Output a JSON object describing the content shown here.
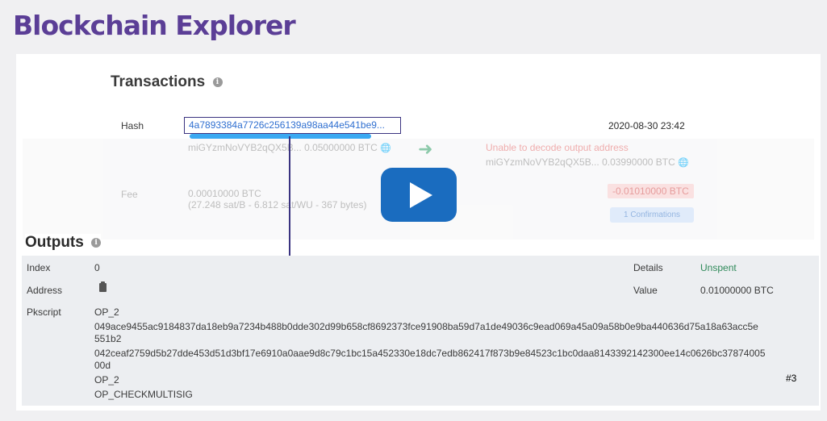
{
  "page_title": "Blockchain Explorer",
  "transactions": {
    "heading": "Transactions",
    "hash_label": "Hash",
    "hash_value": "4a7893384a7726c256139a98aa44e541be9...",
    "date": "2020-08-30 23:42",
    "input_address": "miGYzmNoVYB2qQX5B...",
    "input_amount": "0.05000000 BTC",
    "output_error": "Unable to decode output address",
    "output_address": "miGYzmNoVYB2qQX5B...",
    "output_amount": "0.03990000 BTC",
    "fee_label": "Fee",
    "fee_value": "0.00010000 BTC",
    "fee_detail": "(27.248 sat/B - 6.812 sat/WU - 367 bytes)",
    "net_amount": "-0.01010000 BTC",
    "confirmations": "1 Confirmations"
  },
  "outputs": {
    "heading": "Outputs",
    "index_label": "Index",
    "index_value": "0",
    "address_label": "Address",
    "details_label": "Details",
    "details_value": "Unspent",
    "value_label": "Value",
    "value_value": "0.01000000 BTC",
    "pkscript_label": "Pkscript",
    "pkscript_lines": [
      "OP_2",
      "049ace9455ac9184837da18eb9a7234b488b0dde302d99b658cf8692373fce91908ba59d7a1de49036c9ead069a45a09a58b0e9ba440636d75a18a63acc5e",
      "551b2",
      "042ceaf2759d5b27dde453d51d3bf17e6910a0aae9d8c79c1bc15a452330e18dc7edb862417f873b9e84523c1bc0daa8143392142300ee14c0626bc37874005",
      "00d",
      "OP_2",
      "OP_CHECKMULTISIG"
    ]
  },
  "marker": "#3",
  "colors": {
    "title": "#5b3e96",
    "link": "#2f6fd0",
    "unspent": "#2f8a5a",
    "play_button": "#1a6cbf"
  },
  "icons": [
    "info-icon",
    "arrow-right-icon",
    "globe-icon",
    "clipboard-icon",
    "play-icon"
  ]
}
